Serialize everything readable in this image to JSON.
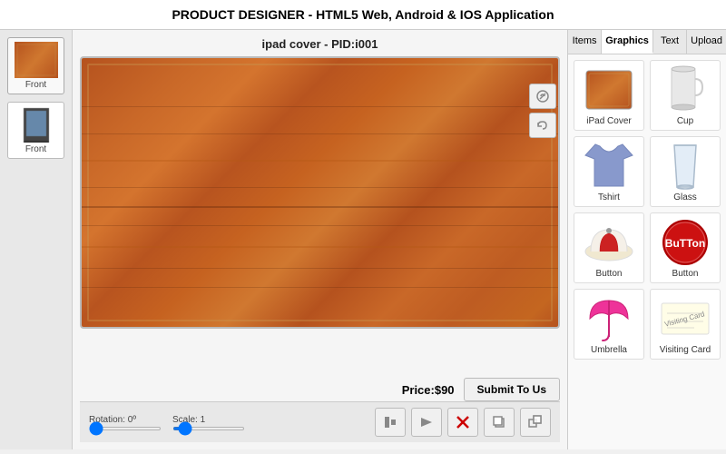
{
  "header": {
    "title": "PRODUCT DESIGNER - HTML5 Web, Android & IOS Application"
  },
  "thumbnails": [
    {
      "label": "Front",
      "type": "cover"
    },
    {
      "label": "Front",
      "type": "device"
    }
  ],
  "canvas": {
    "product_title": "ipad cover - PID:i001",
    "tools": [
      "link-icon",
      "undo-icon"
    ],
    "price": "Price:$90",
    "submit_label": "Submit To Us"
  },
  "controls": {
    "rotation_label": "Rotation: 0º",
    "scale_label": "Scale: 1",
    "buttons": [
      {
        "name": "align-icon",
        "symbol": "▽"
      },
      {
        "name": "flip-icon",
        "symbol": "▶"
      },
      {
        "name": "delete-icon",
        "symbol": "✖"
      },
      {
        "name": "copy-icon",
        "symbol": "❐"
      },
      {
        "name": "front-icon",
        "symbol": "⧉"
      }
    ]
  },
  "panel": {
    "tabs": [
      {
        "label": "Items",
        "active": false
      },
      {
        "label": "Graphics",
        "active": true
      },
      {
        "label": "Text",
        "active": false
      },
      {
        "label": "Upload",
        "active": false
      }
    ],
    "items": [
      {
        "name": "iPad Cover",
        "type": "ipad-cover"
      },
      {
        "name": "Cup",
        "type": "cup"
      },
      {
        "name": "Tshirt",
        "type": "tshirt"
      },
      {
        "name": "Glass",
        "type": "glass"
      },
      {
        "name": "Button",
        "type": "cap"
      },
      {
        "name": "Button",
        "type": "button-red"
      },
      {
        "name": "Umbrella",
        "type": "umbrella"
      },
      {
        "name": "Visiting Card",
        "type": "visiting-card"
      }
    ]
  }
}
